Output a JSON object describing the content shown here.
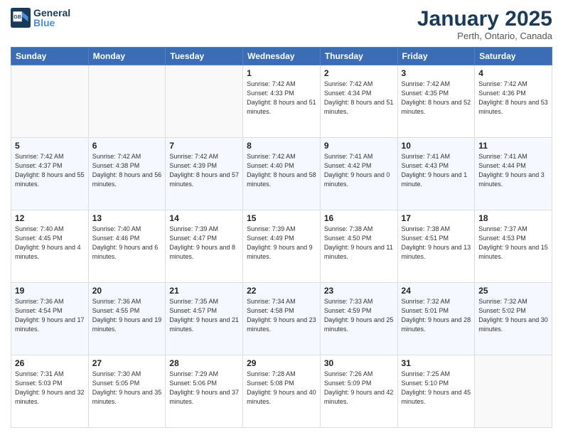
{
  "header": {
    "logo_line1": "General",
    "logo_line2": "Blue",
    "month": "January 2025",
    "location": "Perth, Ontario, Canada"
  },
  "weekdays": [
    "Sunday",
    "Monday",
    "Tuesday",
    "Wednesday",
    "Thursday",
    "Friday",
    "Saturday"
  ],
  "weeks": [
    [
      {
        "day": "",
        "info": ""
      },
      {
        "day": "",
        "info": ""
      },
      {
        "day": "",
        "info": ""
      },
      {
        "day": "1",
        "info": "Sunrise: 7:42 AM\nSunset: 4:33 PM\nDaylight: 8 hours\nand 51 minutes."
      },
      {
        "day": "2",
        "info": "Sunrise: 7:42 AM\nSunset: 4:34 PM\nDaylight: 8 hours\nand 51 minutes."
      },
      {
        "day": "3",
        "info": "Sunrise: 7:42 AM\nSunset: 4:35 PM\nDaylight: 8 hours\nand 52 minutes."
      },
      {
        "day": "4",
        "info": "Sunrise: 7:42 AM\nSunset: 4:36 PM\nDaylight: 8 hours\nand 53 minutes."
      }
    ],
    [
      {
        "day": "5",
        "info": "Sunrise: 7:42 AM\nSunset: 4:37 PM\nDaylight: 8 hours\nand 55 minutes."
      },
      {
        "day": "6",
        "info": "Sunrise: 7:42 AM\nSunset: 4:38 PM\nDaylight: 8 hours\nand 56 minutes."
      },
      {
        "day": "7",
        "info": "Sunrise: 7:42 AM\nSunset: 4:39 PM\nDaylight: 8 hours\nand 57 minutes."
      },
      {
        "day": "8",
        "info": "Sunrise: 7:42 AM\nSunset: 4:40 PM\nDaylight: 8 hours\nand 58 minutes."
      },
      {
        "day": "9",
        "info": "Sunrise: 7:41 AM\nSunset: 4:42 PM\nDaylight: 9 hours\nand 0 minutes."
      },
      {
        "day": "10",
        "info": "Sunrise: 7:41 AM\nSunset: 4:43 PM\nDaylight: 9 hours\nand 1 minute."
      },
      {
        "day": "11",
        "info": "Sunrise: 7:41 AM\nSunset: 4:44 PM\nDaylight: 9 hours\nand 3 minutes."
      }
    ],
    [
      {
        "day": "12",
        "info": "Sunrise: 7:40 AM\nSunset: 4:45 PM\nDaylight: 9 hours\nand 4 minutes."
      },
      {
        "day": "13",
        "info": "Sunrise: 7:40 AM\nSunset: 4:46 PM\nDaylight: 9 hours\nand 6 minutes."
      },
      {
        "day": "14",
        "info": "Sunrise: 7:39 AM\nSunset: 4:47 PM\nDaylight: 9 hours\nand 8 minutes."
      },
      {
        "day": "15",
        "info": "Sunrise: 7:39 AM\nSunset: 4:49 PM\nDaylight: 9 hours\nand 9 minutes."
      },
      {
        "day": "16",
        "info": "Sunrise: 7:38 AM\nSunset: 4:50 PM\nDaylight: 9 hours\nand 11 minutes."
      },
      {
        "day": "17",
        "info": "Sunrise: 7:38 AM\nSunset: 4:51 PM\nDaylight: 9 hours\nand 13 minutes."
      },
      {
        "day": "18",
        "info": "Sunrise: 7:37 AM\nSunset: 4:53 PM\nDaylight: 9 hours\nand 15 minutes."
      }
    ],
    [
      {
        "day": "19",
        "info": "Sunrise: 7:36 AM\nSunset: 4:54 PM\nDaylight: 9 hours\nand 17 minutes."
      },
      {
        "day": "20",
        "info": "Sunrise: 7:36 AM\nSunset: 4:55 PM\nDaylight: 9 hours\nand 19 minutes."
      },
      {
        "day": "21",
        "info": "Sunrise: 7:35 AM\nSunset: 4:57 PM\nDaylight: 9 hours\nand 21 minutes."
      },
      {
        "day": "22",
        "info": "Sunrise: 7:34 AM\nSunset: 4:58 PM\nDaylight: 9 hours\nand 23 minutes."
      },
      {
        "day": "23",
        "info": "Sunrise: 7:33 AM\nSunset: 4:59 PM\nDaylight: 9 hours\nand 25 minutes."
      },
      {
        "day": "24",
        "info": "Sunrise: 7:32 AM\nSunset: 5:01 PM\nDaylight: 9 hours\nand 28 minutes."
      },
      {
        "day": "25",
        "info": "Sunrise: 7:32 AM\nSunset: 5:02 PM\nDaylight: 9 hours\nand 30 minutes."
      }
    ],
    [
      {
        "day": "26",
        "info": "Sunrise: 7:31 AM\nSunset: 5:03 PM\nDaylight: 9 hours\nand 32 minutes."
      },
      {
        "day": "27",
        "info": "Sunrise: 7:30 AM\nSunset: 5:05 PM\nDaylight: 9 hours\nand 35 minutes."
      },
      {
        "day": "28",
        "info": "Sunrise: 7:29 AM\nSunset: 5:06 PM\nDaylight: 9 hours\nand 37 minutes."
      },
      {
        "day": "29",
        "info": "Sunrise: 7:28 AM\nSunset: 5:08 PM\nDaylight: 9 hours\nand 40 minutes."
      },
      {
        "day": "30",
        "info": "Sunrise: 7:26 AM\nSunset: 5:09 PM\nDaylight: 9 hours\nand 42 minutes."
      },
      {
        "day": "31",
        "info": "Sunrise: 7:25 AM\nSunset: 5:10 PM\nDaylight: 9 hours\nand 45 minutes."
      },
      {
        "day": "",
        "info": ""
      }
    ]
  ]
}
